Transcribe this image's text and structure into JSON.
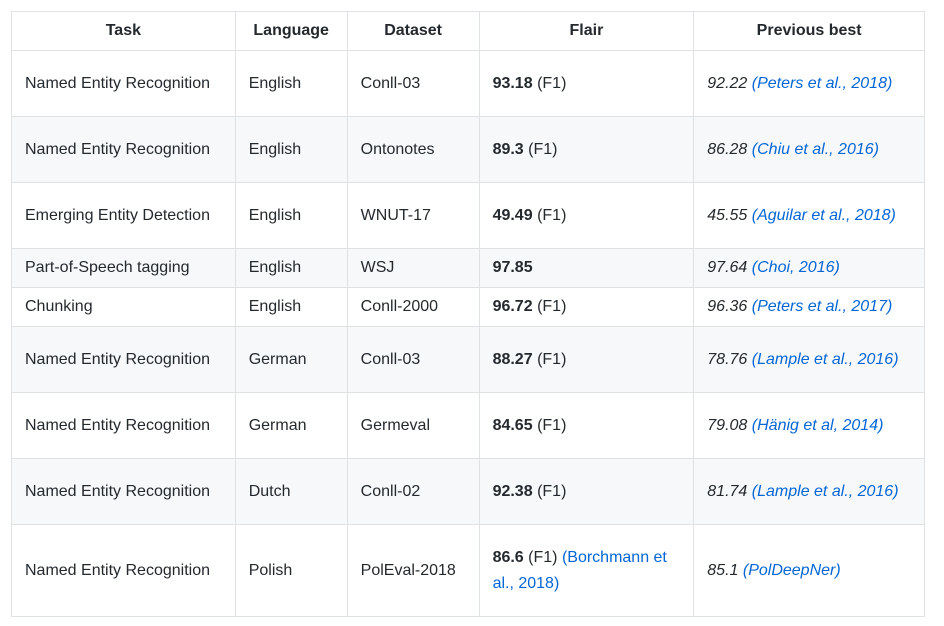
{
  "table": {
    "headers": [
      "Task",
      "Language",
      "Dataset",
      "Flair",
      "Previous best"
    ],
    "rows": [
      {
        "task": "Named Entity Recognition",
        "language": "English",
        "dataset": "Conll-03",
        "flair_score": "93.18",
        "flair_metric": "(F1)",
        "flair_ref": "",
        "prev_score": "92.22",
        "prev_ref": "(Peters et al., 2018)"
      },
      {
        "task": "Named Entity Recognition",
        "language": "English",
        "dataset": "Ontonotes",
        "flair_score": "89.3",
        "flair_metric": "(F1)",
        "flair_ref": "",
        "prev_score": "86.28",
        "prev_ref": "(Chiu et al., 2016)"
      },
      {
        "task": "Emerging Entity Detection",
        "language": "English",
        "dataset": "WNUT-17",
        "flair_score": "49.49",
        "flair_metric": "(F1)",
        "flair_ref": "",
        "prev_score": "45.55",
        "prev_ref": "(Aguilar et al., 2018)"
      },
      {
        "task": "Part-of-Speech tagging",
        "language": "English",
        "dataset": "WSJ",
        "flair_score": "97.85",
        "flair_metric": "",
        "flair_ref": "",
        "prev_score": "97.64",
        "prev_ref": "(Choi, 2016)"
      },
      {
        "task": "Chunking",
        "language": "English",
        "dataset": "Conll-2000",
        "flair_score": "96.72",
        "flair_metric": "(F1)",
        "flair_ref": "",
        "prev_score": "96.36",
        "prev_ref": "(Peters et al., 2017)"
      },
      {
        "task": "Named Entity Recognition",
        "language": "German",
        "dataset": "Conll-03",
        "flair_score": "88.27",
        "flair_metric": "(F1)",
        "flair_ref": "",
        "prev_score": "78.76",
        "prev_ref": "(Lample et al., 2016)"
      },
      {
        "task": "Named Entity Recognition",
        "language": "German",
        "dataset": "Germeval",
        "flair_score": "84.65",
        "flair_metric": "(F1)",
        "flair_ref": "",
        "prev_score": "79.08",
        "prev_ref": "(Hänig et al, 2014)"
      },
      {
        "task": "Named Entity Recognition",
        "language": "Dutch",
        "dataset": "Conll-02",
        "flair_score": "92.38",
        "flair_metric": "(F1)",
        "flair_ref": "",
        "prev_score": "81.74",
        "prev_ref": "(Lample et al., 2016)"
      },
      {
        "task": "Named Entity Recognition",
        "language": "Polish",
        "dataset": "PolEval-2018",
        "flair_score": "86.6",
        "flair_metric": "(F1)",
        "flair_ref": "(Borchmann et al., 2018)",
        "prev_score": "85.1",
        "prev_ref": "(PolDeepNer)"
      }
    ]
  },
  "colors": {
    "link": "#0366d6",
    "border": "#dfe2e5",
    "stripe": "#f6f8fa",
    "text": "#24292e"
  }
}
